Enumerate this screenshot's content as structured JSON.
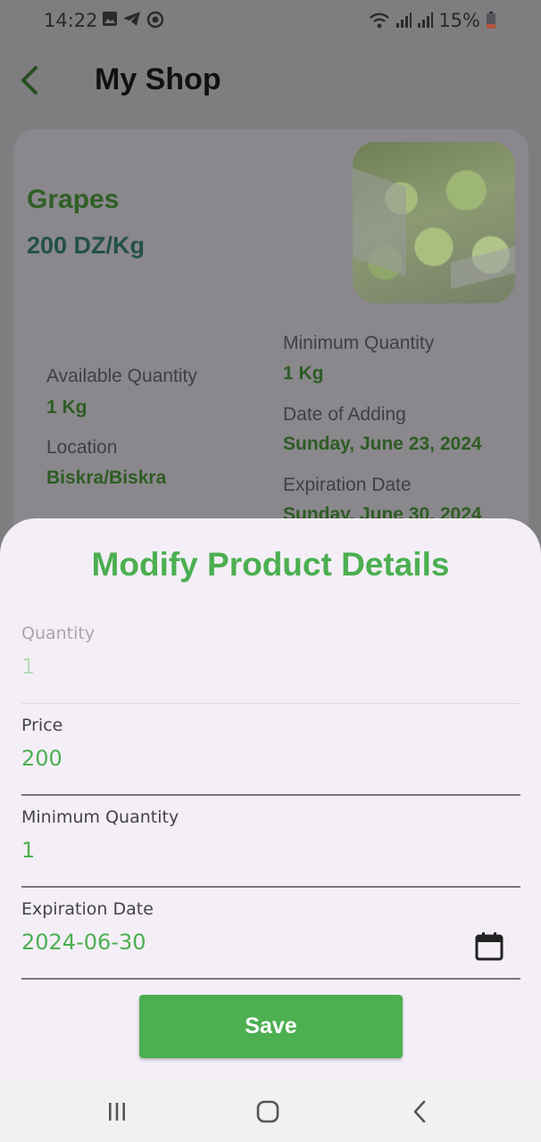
{
  "status_bar": {
    "time": "14:22",
    "battery_percent": "15%",
    "icons": [
      "gallery-icon",
      "telegram-icon",
      "sync-icon",
      "wifi-icon",
      "signal-icon",
      "signal-icon",
      "battery-low-icon"
    ]
  },
  "app_bar": {
    "title": "My Shop",
    "back_icon": "chevron-left-icon"
  },
  "product": {
    "name": "Grapes",
    "price": "200 DZ/Kg",
    "image_alt": "grapes-photo",
    "details": {
      "available_quantity_label": "Available Quantity",
      "available_quantity_value": "1 Kg",
      "location_label": "Location",
      "location_value": "Biskra/Biskra",
      "minimum_quantity_label": "Minimum Quantity",
      "minimum_quantity_value": "1 Kg",
      "date_added_label": "Date of Adding",
      "date_added_value": "Sunday, June 23, 2024",
      "expiration_label": "Expiration Date",
      "expiration_value": "Sunday, June 30, 2024"
    }
  },
  "sheet": {
    "title": "Modify Product Details",
    "fields": [
      {
        "label": "Quantity",
        "value": "1",
        "enabled": false
      },
      {
        "label": "Price",
        "value": "200",
        "enabled": true
      },
      {
        "label": "Minimum Quantity",
        "value": "1",
        "enabled": true
      },
      {
        "label": "Expiration Date",
        "value": "2024-06-30",
        "enabled": true,
        "icon": "calendar-icon"
      }
    ],
    "save_label": "Save"
  },
  "nav_bar": {
    "icons": [
      "recent-apps-icon",
      "home-icon",
      "back-icon"
    ]
  },
  "colors": {
    "accent": "#4caf50",
    "sheet_bg": "#f4eff7",
    "scrim": "#7e7d80"
  }
}
